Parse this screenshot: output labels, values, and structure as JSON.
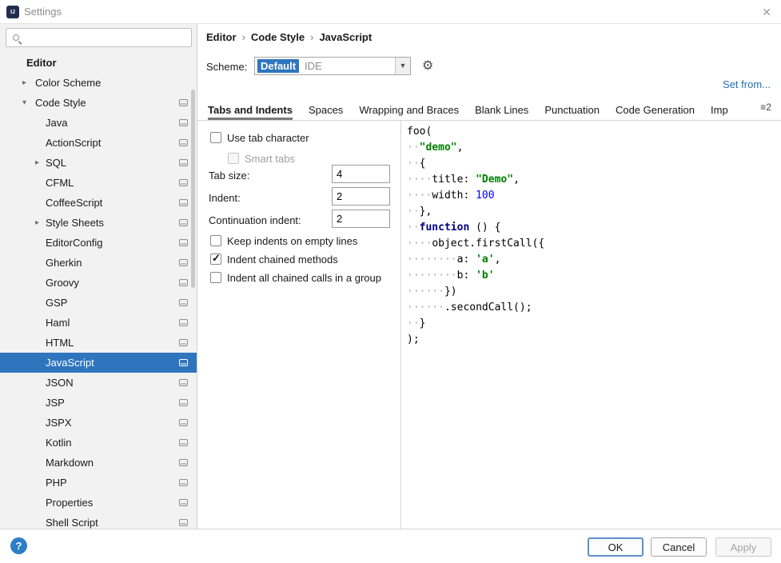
{
  "window": {
    "title": "Settings",
    "close_glyph": "✕"
  },
  "colors": {
    "selection": "#2E75BE",
    "link": "#2470B3",
    "string": "#008000",
    "number": "#0000FF",
    "keyword": "#000080"
  },
  "sidebar": {
    "search_placeholder": "",
    "items": [
      {
        "label": "Editor",
        "level": 0,
        "arrow": "",
        "icon": false,
        "selected": false
      },
      {
        "label": "Color Scheme",
        "level": 1,
        "arrow": "right",
        "icon": false,
        "selected": false
      },
      {
        "label": "Code Style",
        "level": 1,
        "arrow": "down",
        "icon": true,
        "selected": false
      },
      {
        "label": "Java",
        "level": 2,
        "arrow": "",
        "icon": true,
        "selected": false
      },
      {
        "label": "ActionScript",
        "level": 2,
        "arrow": "",
        "icon": true,
        "selected": false
      },
      {
        "label": "SQL",
        "level": 2,
        "arrow": "right",
        "icon": true,
        "selected": false
      },
      {
        "label": "CFML",
        "level": 2,
        "arrow": "",
        "icon": true,
        "selected": false
      },
      {
        "label": "CoffeeScript",
        "level": 2,
        "arrow": "",
        "icon": true,
        "selected": false
      },
      {
        "label": "Style Sheets",
        "level": 2,
        "arrow": "right",
        "icon": true,
        "selected": false
      },
      {
        "label": "EditorConfig",
        "level": 2,
        "arrow": "",
        "icon": true,
        "selected": false
      },
      {
        "label": "Gherkin",
        "level": 2,
        "arrow": "",
        "icon": true,
        "selected": false
      },
      {
        "label": "Groovy",
        "level": 2,
        "arrow": "",
        "icon": true,
        "selected": false
      },
      {
        "label": "GSP",
        "level": 2,
        "arrow": "",
        "icon": true,
        "selected": false
      },
      {
        "label": "Haml",
        "level": 2,
        "arrow": "",
        "icon": true,
        "selected": false
      },
      {
        "label": "HTML",
        "level": 2,
        "arrow": "",
        "icon": true,
        "selected": false
      },
      {
        "label": "JavaScript",
        "level": 2,
        "arrow": "",
        "icon": true,
        "selected": true
      },
      {
        "label": "JSON",
        "level": 2,
        "arrow": "",
        "icon": true,
        "selected": false
      },
      {
        "label": "JSP",
        "level": 2,
        "arrow": "",
        "icon": true,
        "selected": false
      },
      {
        "label": "JSPX",
        "level": 2,
        "arrow": "",
        "icon": true,
        "selected": false
      },
      {
        "label": "Kotlin",
        "level": 2,
        "arrow": "",
        "icon": true,
        "selected": false
      },
      {
        "label": "Markdown",
        "level": 2,
        "arrow": "",
        "icon": true,
        "selected": false
      },
      {
        "label": "PHP",
        "level": 2,
        "arrow": "",
        "icon": true,
        "selected": false
      },
      {
        "label": "Properties",
        "level": 2,
        "arrow": "",
        "icon": true,
        "selected": false
      },
      {
        "label": "Shell Script",
        "level": 2,
        "arrow": "",
        "icon": true,
        "selected": false
      }
    ]
  },
  "breadcrumb": {
    "separator": "›",
    "segments": [
      "Editor",
      "Code Style",
      "JavaScript"
    ]
  },
  "scheme": {
    "label": "Scheme:",
    "value": "Default",
    "suffix": "IDE"
  },
  "set_from_label": "Set from...",
  "tabs": {
    "items": [
      {
        "label": "Tabs and Indents",
        "selected": true
      },
      {
        "label": "Spaces",
        "selected": false
      },
      {
        "label": "Wrapping and Braces",
        "selected": false
      },
      {
        "label": "Blank Lines",
        "selected": false
      },
      {
        "label": "Punctuation",
        "selected": false
      },
      {
        "label": "Code Generation",
        "selected": false
      },
      {
        "label": "Imp",
        "selected": false
      }
    ],
    "hidden_count": "2"
  },
  "form": {
    "use_tab_character": {
      "label": "Use tab character",
      "checked": false
    },
    "smart_tabs": {
      "label": "Smart tabs",
      "checked": false,
      "disabled": true
    },
    "tab_size": {
      "label": "Tab size:",
      "value": "4"
    },
    "indent": {
      "label": "Indent:",
      "value": "2"
    },
    "continuation_indent": {
      "label": "Continuation indent:",
      "value": "2"
    },
    "keep_indents": {
      "label": "Keep indents on empty lines",
      "checked": false
    },
    "indent_chained": {
      "label": "Indent chained methods",
      "checked": true
    },
    "indent_all_chained": {
      "label": "Indent all chained calls in a group",
      "checked": false
    }
  },
  "preview": {
    "lines": [
      {
        "tokens": [
          {
            "text": "foo(",
            "type": "plain"
          }
        ]
      },
      {
        "tokens": [
          {
            "text": "··",
            "type": "ws"
          },
          {
            "text": "\"demo\"",
            "type": "string"
          },
          {
            "text": ",",
            "type": "plain"
          }
        ]
      },
      {
        "tokens": [
          {
            "text": "··",
            "type": "ws"
          },
          {
            "text": "{",
            "type": "plain"
          }
        ]
      },
      {
        "tokens": [
          {
            "text": "····",
            "type": "ws"
          },
          {
            "text": "title: ",
            "type": "plain"
          },
          {
            "text": "\"Demo\"",
            "type": "string"
          },
          {
            "text": ",",
            "type": "plain"
          }
        ]
      },
      {
        "tokens": [
          {
            "text": "····",
            "type": "ws"
          },
          {
            "text": "width: ",
            "type": "plain"
          },
          {
            "text": "100",
            "type": "number"
          }
        ]
      },
      {
        "tokens": [
          {
            "text": "··",
            "type": "ws"
          },
          {
            "text": "},",
            "type": "plain"
          }
        ]
      },
      {
        "tokens": [
          {
            "text": "··",
            "type": "ws"
          },
          {
            "text": "function",
            "type": "keyword"
          },
          {
            "text": " () {",
            "type": "plain"
          }
        ]
      },
      {
        "tokens": [
          {
            "text": "····",
            "type": "ws"
          },
          {
            "text": "object.firstCall({",
            "type": "plain"
          }
        ]
      },
      {
        "tokens": [
          {
            "text": "········",
            "type": "ws"
          },
          {
            "text": "a: ",
            "type": "plain"
          },
          {
            "text": "'a'",
            "type": "string"
          },
          {
            "text": ",",
            "type": "plain"
          }
        ]
      },
      {
        "tokens": [
          {
            "text": "········",
            "type": "ws"
          },
          {
            "text": "b: ",
            "type": "plain"
          },
          {
            "text": "'b'",
            "type": "string"
          }
        ]
      },
      {
        "tokens": [
          {
            "text": "······",
            "type": "ws"
          },
          {
            "text": "})",
            "type": "plain"
          }
        ]
      },
      {
        "tokens": [
          {
            "text": "······",
            "type": "ws"
          },
          {
            "text": ".secondCall();",
            "type": "plain"
          }
        ]
      },
      {
        "tokens": [
          {
            "text": "··",
            "type": "ws"
          },
          {
            "text": "}",
            "type": "plain"
          }
        ]
      },
      {
        "tokens": [
          {
            "text": ");",
            "type": "plain"
          }
        ]
      }
    ]
  },
  "footer": {
    "help_glyph": "?",
    "ok": "OK",
    "cancel": "Cancel",
    "apply": "Apply"
  }
}
